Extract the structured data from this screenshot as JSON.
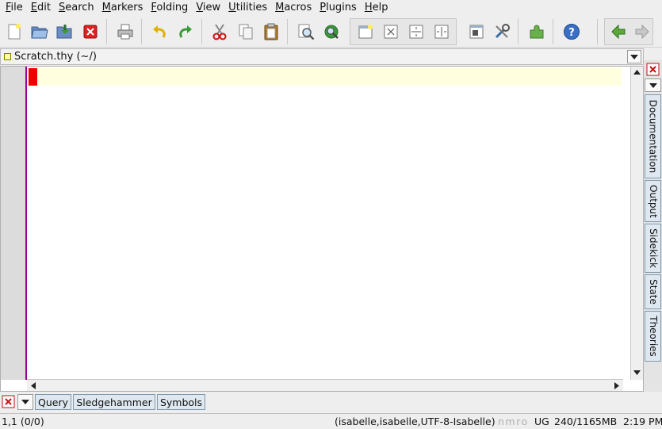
{
  "menu": [
    {
      "mnemonic": "F",
      "rest": "ile"
    },
    {
      "mnemonic": "E",
      "rest": "dit"
    },
    {
      "mnemonic": "S",
      "rest": "earch"
    },
    {
      "mnemonic": "M",
      "rest": "arkers"
    },
    {
      "mnemonic": "F",
      "rest": "olding"
    },
    {
      "mnemonic": "V",
      "rest": "iew"
    },
    {
      "mnemonic": "U",
      "rest": "tilities"
    },
    {
      "mnemonic": "M",
      "rest": "acros"
    },
    {
      "mnemonic": "P",
      "rest": "lugins"
    },
    {
      "mnemonic": "H",
      "rest": "elp"
    }
  ],
  "toolbar": {
    "icons": [
      "new-file-icon",
      "open-file-icon",
      "save-icon",
      "close-file-icon",
      "print-icon",
      "undo-icon",
      "redo-icon",
      "cut-icon",
      "copy-icon",
      "paste-icon",
      "find-icon",
      "find-in-files-icon",
      "new-view-icon",
      "unsplit-icon",
      "split-horizontal-icon",
      "split-vertical-icon",
      "options-icon",
      "tools-icon",
      "plugin-manager-icon",
      "help-icon",
      "navigate-back-icon",
      "navigate-forward-icon"
    ]
  },
  "buffer": {
    "label": "Scratch.thy (~/)"
  },
  "right_dock": {
    "tabs": [
      "Documentation",
      "Output",
      "Sidekick",
      "State",
      "Theories"
    ]
  },
  "bottom_dock": {
    "tabs": [
      "Query",
      "Sledgehammer",
      "Symbols"
    ]
  },
  "status": {
    "position": "1,1 (0/0)",
    "mode": "(isabelle,isabelle,UTF-8-Isabelle)",
    "flags": "nmro",
    "input": "UG",
    "memory": "240/1165MB",
    "time": "2:19 PM"
  },
  "colors": {
    "caret": "#ee0000",
    "current_line": "#ffffe0",
    "gutter_border": "#990099",
    "tab_fill": "#dfe8f0"
  }
}
